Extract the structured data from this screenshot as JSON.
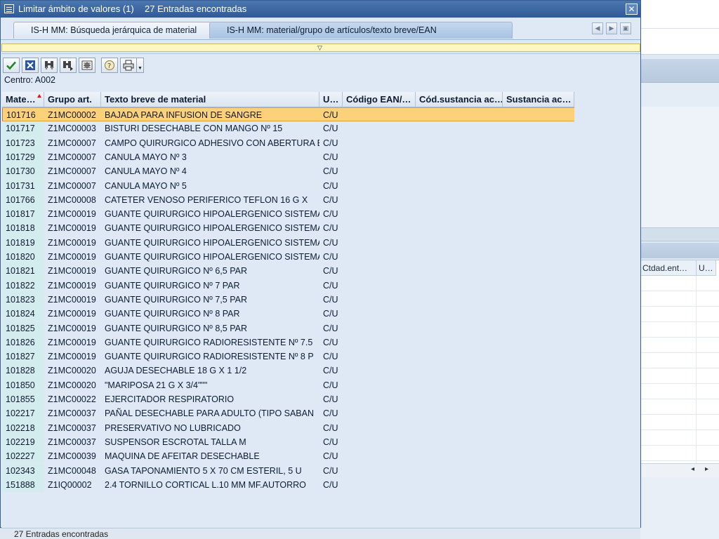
{
  "dialog": {
    "title": "Limitar ámbito de valores (1)",
    "title_count": "27 Entradas encontradas",
    "close_glyph": "✕"
  },
  "tabs": [
    {
      "label": "IS-H MM: Búsqueda jerárquica de material",
      "active": false
    },
    {
      "label": "IS-H MM: material/grupo de artículos/texto breve/EAN",
      "active": true
    }
  ],
  "toolbar": {
    "buttons": [
      "check-icon",
      "cancel-icon",
      "find-icon",
      "find-next-icon",
      "filter-icon",
      "help-icon",
      "print-icon"
    ]
  },
  "centro_label": "Centro: A002",
  "table": {
    "columns": [
      {
        "key": "mat",
        "label": "Mate…"
      },
      {
        "key": "grp",
        "label": "Grupo art."
      },
      {
        "key": "txt",
        "label": "Texto breve de material"
      },
      {
        "key": "um",
        "label": "U…"
      },
      {
        "key": "ean",
        "label": "Código EAN/…"
      },
      {
        "key": "csa",
        "label": "Cód.sustancia ac…"
      },
      {
        "key": "sa",
        "label": "Sustancia ac…"
      }
    ],
    "selected_row": 0,
    "rows": [
      [
        "101716",
        "Z1MC00002",
        "BAJADA PARA INFUSION DE SANGRE",
        "C/U"
      ],
      [
        "101717",
        "Z1MC00003",
        "BISTURI DESECHABLE CON MANGO Nº 15",
        "C/U"
      ],
      [
        "101723",
        "Z1MC00007",
        "CAMPO QUIRURGICO ADHESIVO CON ABERTURA E",
        "C/U"
      ],
      [
        "101729",
        "Z1MC00007",
        "CANULA MAYO Nº 3",
        "C/U"
      ],
      [
        "101730",
        "Z1MC00007",
        "CANULA MAYO Nº 4",
        "C/U"
      ],
      [
        "101731",
        "Z1MC00007",
        "CANULA MAYO Nº 5",
        "C/U"
      ],
      [
        "101766",
        "Z1MC00008",
        "CATETER VENOSO PERIFERICO TEFLON 16 G X",
        "C/U"
      ],
      [
        "101817",
        "Z1MC00019",
        "GUANTE QUIRURGICO HIPOALERGENICO SISTEMA",
        "C/U"
      ],
      [
        "101818",
        "Z1MC00019",
        "GUANTE QUIRURGICO HIPOALERGENICO SISTEMA",
        "C/U"
      ],
      [
        "101819",
        "Z1MC00019",
        "GUANTE QUIRURGICO HIPOALERGENICO SISTEMA",
        "C/U"
      ],
      [
        "101820",
        "Z1MC00019",
        "GUANTE QUIRURGICO HIPOALERGENICO SISTEMA",
        "C/U"
      ],
      [
        "101821",
        "Z1MC00019",
        "GUANTE QUIRURGICO Nº 6,5 PAR",
        "C/U"
      ],
      [
        "101822",
        "Z1MC00019",
        "GUANTE QUIRURGICO Nº 7 PAR",
        "C/U"
      ],
      [
        "101823",
        "Z1MC00019",
        "GUANTE QUIRURGICO Nº 7,5 PAR",
        "C/U"
      ],
      [
        "101824",
        "Z1MC00019",
        "GUANTE QUIRURGICO Nº 8 PAR",
        "C/U"
      ],
      [
        "101825",
        "Z1MC00019",
        "GUANTE QUIRURGICO Nº 8,5 PAR",
        "C/U"
      ],
      [
        "101826",
        "Z1MC00019",
        "GUANTE QUIRURGICO RADIORESISTENTE Nº 7.5",
        "C/U"
      ],
      [
        "101827",
        "Z1MC00019",
        "GUANTE QUIRURGICO RADIORESISTENTE Nº 8 P",
        "C/U"
      ],
      [
        "101828",
        "Z1MC00020",
        "AGUJA DESECHABLE 18 G X 1 1/2",
        "C/U"
      ],
      [
        "101850",
        "Z1MC00020",
        "\"MARIPOSA 21 G X 3/4\"\"\"",
        "C/U"
      ],
      [
        "101855",
        "Z1MC00022",
        "EJERCITADOR RESPIRATORIO",
        "C/U"
      ],
      [
        "102217",
        "Z1MC00037",
        "PAÑAL DESECHABLE PARA ADULTO (TIPO SABAN",
        "C/U"
      ],
      [
        "102218",
        "Z1MC00037",
        "PRESERVATIVO NO LUBRICADO",
        "C/U"
      ],
      [
        "102219",
        "Z1MC00037",
        "SUSPENSOR ESCROTAL TALLA M",
        "C/U"
      ],
      [
        "102227",
        "Z1MC00039",
        "MAQUINA DE AFEITAR DESECHABLE",
        "C/U"
      ],
      [
        "102343",
        "Z1MC00048",
        "GASA TAPONAMIENTO 5 X 70 CM ESTERIL, 5 U",
        "C/U"
      ],
      [
        "151888",
        "Z1IQ00002",
        "2.4 TORNILLO CORTICAL L.10 MM MF.AUTORRO",
        "C/U"
      ]
    ]
  },
  "background": {
    "col1_label": "Ctdad.ent…",
    "col2_label": "U…",
    "status_text": "27 Entradas encontradas"
  },
  "colors": {
    "titlebar": "#2f5a96",
    "selected_row": "#fdd07a",
    "key_column": "#d4ecee",
    "sort_indicator": "#d21b1b"
  }
}
